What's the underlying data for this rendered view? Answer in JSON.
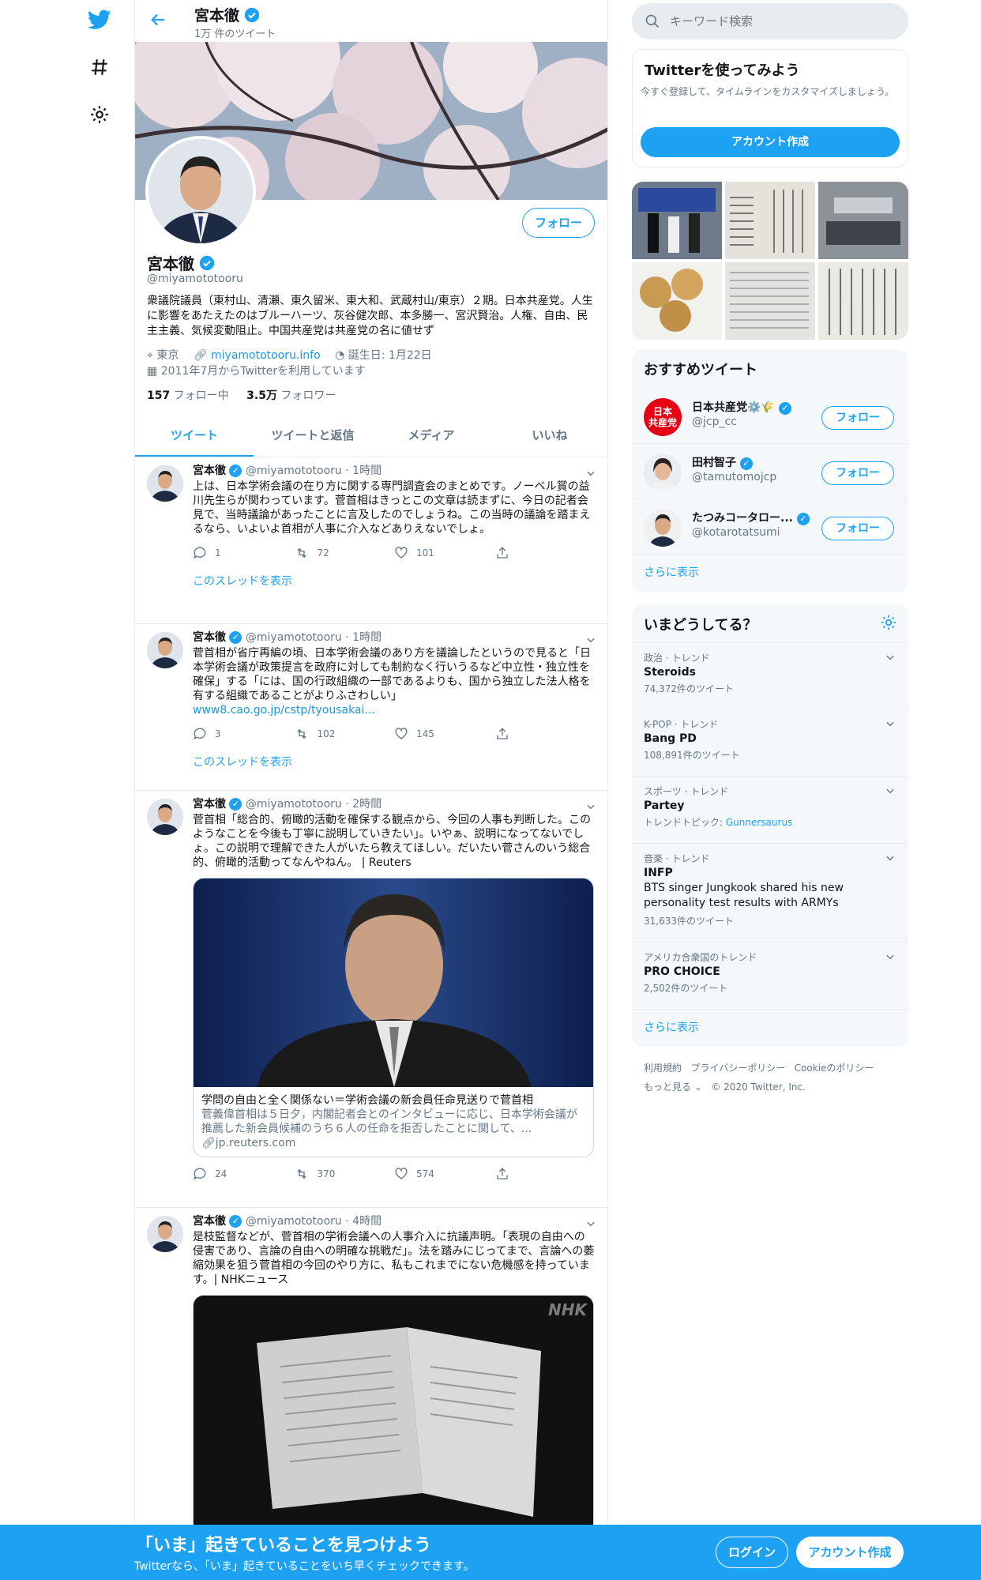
{
  "nav": {
    "icons": [
      "twitter-bird-icon",
      "hashtag-icon",
      "gear-icon"
    ]
  },
  "header": {
    "name": "宮本徹",
    "tweet_count": "1万 件のツイート"
  },
  "profile": {
    "name": "宮本徹",
    "handle": "@miyamototooru",
    "follow_label": "フォロー",
    "bio": "衆議院議員（東村山、清瀬、東久留米、東大和、武蔵村山/東京）２期。日本共産党。人生に影響をあたえたのはブルーハーツ、灰谷健次郎、本多勝一、宮沢賢治。人権、自由、民主主義、気候変動阻止。中国共産党は共産党の名に値せず",
    "location": "東京",
    "url": "miyamototooru.info",
    "birthday": "誕生日: 1月22日",
    "joined": "2011年7月からTwitterを利用しています",
    "following_count": "157",
    "following_label": "フォロー中",
    "followers_count": "3.5万",
    "followers_label": "フォロワー"
  },
  "tabs": [
    "ツイート",
    "ツイートと返信",
    "メディア",
    "いいね"
  ],
  "tweets": [
    {
      "name": "宮本徹",
      "handle": "@miyamototooru",
      "time": "1時間",
      "text": "上は、日本学術会議の在り方に関する専門調査会のまとめです。ノーベル賞の益川先生らが関わっています。菅首相はきっとこの文章は読まずに、今日の記者会見で、当時議論があったことに言及したのでしょうね。この当時の議論を踏まえるなら、いよいよ首相が人事に介入などありえないでしょ。",
      "link": "",
      "replies": "1",
      "retweets": "72",
      "likes": "101",
      "thread": "このスレッドを表示"
    },
    {
      "name": "宮本徹",
      "handle": "@miyamototooru",
      "time": "1時間",
      "text": "菅首相が省庁再編の頃、日本学術会議のあり方を議論したというので見ると「日本学術会議が政策提言を政府に対しても制約なく行いうるなど中立性・独立性を確保」する「には、国の行政組織の一部であるよりも、国から独立した法人格を有する組織であることがよりふさわしい」",
      "link": "www8.cao.go.jp/cstp/tyousakai...",
      "replies": "3",
      "retweets": "102",
      "likes": "145",
      "thread": "このスレッドを表示"
    },
    {
      "name": "宮本徹",
      "handle": "@miyamototooru",
      "time": "2時間",
      "text": "菅首相「総合的、俯瞰的活動を確保する観点から、今回の人事も判断した。このようなことを今後も丁寧に説明していきたい」。いやぁ、説明になってないでしょ。この説明で理解できた人がいたら教えてほしい。だいたい菅さんのいう総合的、俯瞰的活動ってなんやねん。 | Reuters",
      "card_title": "学問の自由と全く関係ない＝学術会議の新会員任命見送りで菅首相",
      "card_desc": "菅義偉首相は５日夕，内閣記者会とのインタビューに応じ、日本学術会議が推薦した新会員候補のうち６人の任命を拒否したことに関して、...",
      "card_domain": "jp.reuters.com",
      "replies": "24",
      "retweets": "370",
      "likes": "574"
    },
    {
      "name": "宮本徹",
      "handle": "@miyamototooru",
      "time": "4時間",
      "text": "是枝監督などが、菅首相の学術会議への人事介入に抗議声明。「表現の自由への侵害であり、言論の自由への明確な挑戦だ」。法を踏みにじってまで、言論への萎縮効果を狙う菅首相の今回のやり方に、私もこれまでにない危機感を持っています。| NHKニュース",
      "card_watermark": "NHK"
    }
  ],
  "right": {
    "search_placeholder": "キーワード検索",
    "signup": {
      "title": "Twitterを使ってみよう",
      "desc": "今すぐ登録して、タイムラインをカスタマイズしましょう。",
      "button": "アカウント作成"
    },
    "suggest": {
      "title": "おすすめツイート",
      "items": [
        {
          "name": "日本共産党⚙️🌾",
          "handle": "@jcp_cc",
          "button": "フォロー",
          "logo": "日本\n共産党"
        },
        {
          "name": "田村智子",
          "handle": "@tamutomojcp",
          "button": "フォロー"
        },
        {
          "name": "たつみコータロー...",
          "handle": "@kotarotatsumi",
          "button": "フォロー"
        }
      ],
      "more": "さらに表示"
    },
    "trends": {
      "title": "いまどうしてる？",
      "items": [
        {
          "cat": "政治 · トレンド",
          "name": "Steroids",
          "count": "74,372件のツイート"
        },
        {
          "cat": "K-POP · トレンド",
          "name": "Bang PD",
          "count": "108,891件のツイート"
        },
        {
          "cat": "スポーツ · トレンド",
          "name": "Partey",
          "count": "トレンドトピック: ",
          "count_link": "Gunnersaurus"
        },
        {
          "cat": "音楽 · トレンド",
          "name": "INFP",
          "desc": "BTS singer Jungkook shared his new personality test results with ARMYs",
          "count": "31,633件のツイート"
        },
        {
          "cat": "アメリカ合衆国のトレンド",
          "name": "PRO CHOICE",
          "count": "2,502件のツイート"
        }
      ],
      "more": "さらに表示"
    },
    "footer": {
      "links": [
        "利用規約",
        "プライバシーポリシー",
        "Cookieのポリシー"
      ],
      "more": "もっと見る",
      "copyright": "© 2020 Twitter, Inc."
    }
  },
  "bottom": {
    "title": "「いま」起きていることを見つけよう",
    "subtitle": "Twitterなら、「いま」起きていることをいち早くチェックできます。",
    "login": "ログイン",
    "signup": "アカウント作成"
  },
  "colors": {
    "accent": "#1da1f2",
    "text": "#14171a",
    "muted": "#657786"
  }
}
